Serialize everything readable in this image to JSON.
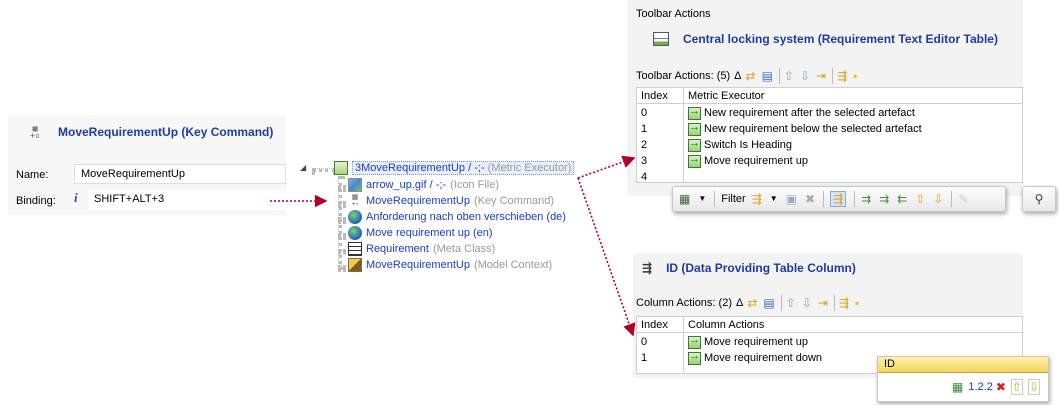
{
  "command_panel": {
    "title": "MoveRequirementUp (Key Command)",
    "name_label": "Name:",
    "name_value": "MoveRequirementUp",
    "binding_label": "Binding:",
    "binding_info": "i",
    "binding_value": "SHIFT+ALT+3"
  },
  "tree": {
    "root": {
      "label": "3MoveRequirementUp / -;-",
      "type": "(Metric Executor)"
    },
    "children": [
      {
        "label": "arrow_up.gif / -;-",
        "type": "(Icon File)"
      },
      {
        "label": "MoveRequirementUp",
        "type": "(Key Command)"
      },
      {
        "label": "Anforderung nach oben verschieben (de)",
        "type": ""
      },
      {
        "label": "Move requirement up (en)",
        "type": ""
      },
      {
        "label": "Requirement",
        "type": "(Meta Class)"
      },
      {
        "label": "MoveRequirementUp",
        "type": "(Model Context)"
      }
    ]
  },
  "toolbar_panel": {
    "caption": "Toolbar Actions",
    "title": "Central locking system (Requirement Text Editor Table)",
    "section_label": "Toolbar Actions: (5)",
    "delta": "Δ",
    "headers": [
      "Index",
      "Metric Executor"
    ],
    "rows": [
      {
        "index": "0",
        "label": "New requirement after the selected artefact"
      },
      {
        "index": "1",
        "label": "New requirement below the selected artefact"
      },
      {
        "index": "2",
        "label": "Switch Is Heading"
      },
      {
        "index": "3",
        "label": "Move requirement up"
      },
      {
        "index": "4",
        "label": ""
      }
    ]
  },
  "floating_toolbar": {
    "filter_label": "Filter",
    "search_icon": "magnifier-icon"
  },
  "column_panel": {
    "title": "ID (Data Providing Table Column)",
    "section_label": "Column Actions: (2)",
    "delta": "Δ",
    "headers": [
      "Index",
      "Column Actions"
    ],
    "rows": [
      {
        "index": "0",
        "label": "Move requirement up"
      },
      {
        "index": "1",
        "label": "Move requirement down"
      }
    ]
  },
  "id_table": {
    "header": "ID",
    "value": "1.2.2"
  },
  "colors": {
    "title_blue": "#1e3ca0",
    "link_blue": "#1a3cc8",
    "arrow_red": "#b0002a",
    "header_gold": "#f4d460"
  }
}
